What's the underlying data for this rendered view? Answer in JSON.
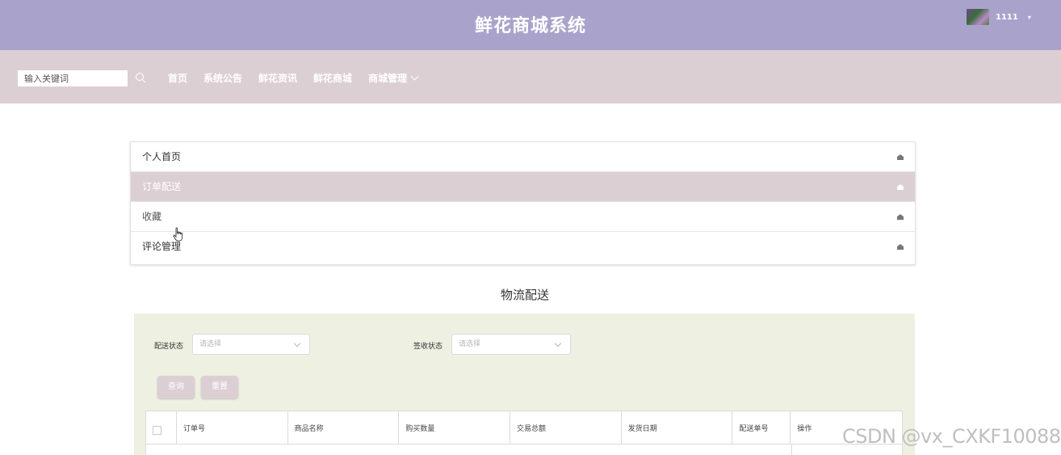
{
  "header": {
    "title": "鲜花商城系统",
    "username": "1111",
    "caret": "▾"
  },
  "nav": {
    "search_placeholder": "输入关键词",
    "links": [
      "首页",
      "系统公告",
      "鲜花资讯",
      "鲜花商城",
      "商城管理"
    ]
  },
  "menu": {
    "items": [
      {
        "label": "个人首页",
        "active": false
      },
      {
        "label": "订单配送",
        "active": true
      },
      {
        "label": "收藏",
        "active": false
      },
      {
        "label": "评论管理",
        "active": false
      }
    ]
  },
  "section": {
    "title": "物流配送"
  },
  "filters": {
    "delivery_status_label": "配送状态",
    "delivery_status_placeholder": "请选择",
    "sign_status_label": "签收状态",
    "sign_status_placeholder": "请选择"
  },
  "buttons": {
    "query": "查询",
    "reset": "重置"
  },
  "table": {
    "columns": [
      "订单号",
      "商品名称",
      "购买数量",
      "交易总额",
      "发货日期",
      "配送单号",
      "操作"
    ]
  },
  "watermark": "CSDN @vx_CXKF10088",
  "colors": {
    "header_bg": "#a9a3cc",
    "nav_bg": "#dccfd4",
    "panel_bg": "#eef0e2"
  }
}
